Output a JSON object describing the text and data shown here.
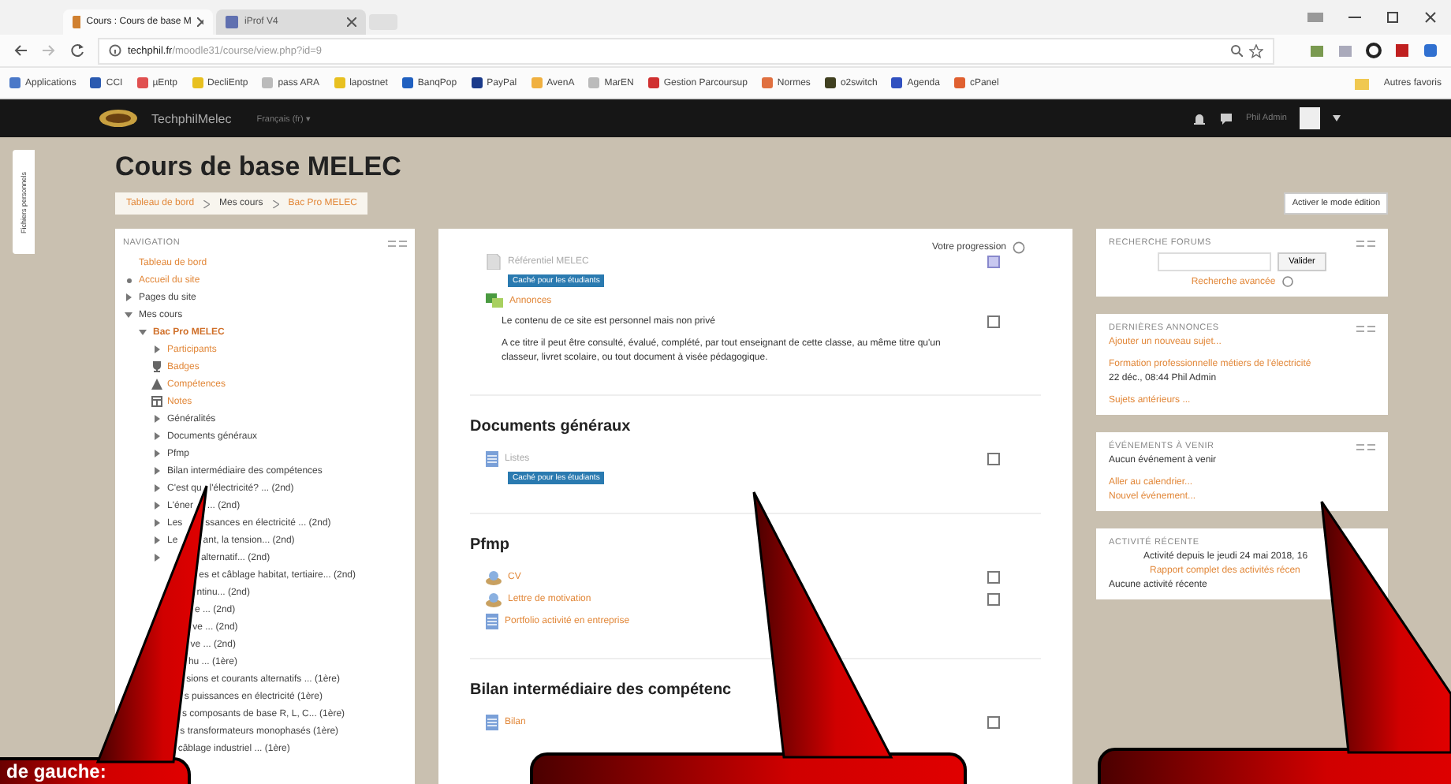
{
  "browser": {
    "tabs": [
      {
        "title": "Cours : Cours de base M",
        "selected": true
      },
      {
        "title": "iProf V4",
        "selected": false
      }
    ],
    "url_host": "techphil.fr",
    "url_path": "/moodle31/course/view.php?id=9",
    "bookmarks": [
      {
        "label": "Applications",
        "color": "#4a78c8"
      },
      {
        "label": "CCI",
        "color": "#2a5ab0"
      },
      {
        "label": "µEntp",
        "color": "#e05050"
      },
      {
        "label": "DecliEntp",
        "color": "#e8c020"
      },
      {
        "label": "pass ARA",
        "color": "#bbbbbb"
      },
      {
        "label": "lapostnet",
        "color": "#e8c020"
      },
      {
        "label": "BanqPop",
        "color": "#2060c0"
      },
      {
        "label": "PayPal",
        "color": "#1a3a8a"
      },
      {
        "label": "AvenA",
        "color": "#f0b040"
      },
      {
        "label": "MarEN",
        "color": "#bbbbbb"
      },
      {
        "label": "Gestion Parcoursup",
        "color": "#d03030"
      },
      {
        "label": "Normes",
        "color": "#e07040"
      },
      {
        "label": "o2switch",
        "color": "#404020"
      },
      {
        "label": "Agenda",
        "color": "#3050c0"
      },
      {
        "label": "cPanel",
        "color": "#e06030"
      }
    ],
    "other_bookmarks": "Autres favoris"
  },
  "navbar": {
    "site_name": "TechphilMelec",
    "language": "Français (fr) ▾",
    "user": "Phil Admin"
  },
  "drawer_tab": "Fichiers personnels",
  "course_title": "Cours de base MELEC",
  "breadcrumb": [
    "Tableau de bord",
    "Mes cours",
    "Bac Pro MELEC"
  ],
  "edit_button": "Activer le mode édition",
  "navigation": {
    "title": "NAVIGATION",
    "items": [
      {
        "text": "Tableau de bord",
        "kind": "root"
      },
      {
        "text": "Accueil du site",
        "kind": "bullet"
      },
      {
        "text": "Pages du site",
        "kind": "node",
        "expanded": false
      },
      {
        "text": "Mes cours",
        "kind": "node",
        "expanded": true,
        "children": [
          {
            "text": "Bac Pro MELEC",
            "kind": "course",
            "expanded": true,
            "children": [
              {
                "text": "Participants",
                "kind": "link-node",
                "expanded": false
              },
              {
                "text": "Badges",
                "kind": "trophy"
              },
              {
                "text": "Compétences",
                "kind": "triangle"
              },
              {
                "text": "Notes",
                "kind": "table"
              },
              {
                "text": "Généralités",
                "kind": "node",
                "expanded": false
              },
              {
                "text": "Documents généraux",
                "kind": "node",
                "expanded": false
              },
              {
                "text": "Pfmp",
                "kind": "node",
                "expanded": false
              },
              {
                "text": "Bilan intermédiaire des compétences",
                "kind": "node",
                "expanded": false
              },
              {
                "text": "C'est qu",
                "tail": "l'électricité? ... (2nd)",
                "kind": "node",
                "expanded": false
              },
              {
                "text": "L'éner",
                "tail": "... (2nd)",
                "kind": "node",
                "expanded": false
              },
              {
                "text": "Les",
                "tail": "ssances en électricité ... (2nd)",
                "kind": "node",
                "expanded": false
              },
              {
                "text": "Le",
                "tail": "ant, la tension... (2nd)",
                "kind": "node",
                "expanded": false
              },
              {
                "tail": "alternatif... (2nd)",
                "expanded": false
              },
              {
                "tail": "es et câblage habitat, tertiaire... (2nd)"
              },
              {
                "tail": "ntinu... (2nd)"
              },
              {
                "tail": "e ... (2nd)"
              },
              {
                "tail": "ve ... (2nd)"
              },
              {
                "tail": "ve ... (2nd)"
              },
              {
                "tail": "hu ... (1ère)"
              },
              {
                "tail": "sions et courants alternatifs ... (1ère)"
              },
              {
                "tail": "s puissances en électricité (1ère)"
              },
              {
                "tail": "s composants de base R, L, C... (1ère)"
              },
              {
                "tail": "s transformateurs monophasés (1ère)"
              },
              {
                "tail": "câblage industriel ... (1ère)"
              }
            ]
          }
        ]
      }
    ]
  },
  "progress_label": "Votre progression",
  "sections": [
    {
      "activities": [
        {
          "name": "Référentiel MELEC",
          "kind": "file",
          "hidden": true,
          "badge": "Caché pour les étudiants",
          "checked": true
        },
        {
          "name": "Annonces",
          "kind": "forum",
          "hidden": false
        }
      ],
      "texts": [
        "Le contenu de ce site est personnel mais non privé",
        "A ce titre il peut être consulté, évalué, complété, par tout enseignant de cette classe, au même titre qu'un classeur, livret scolaire, ou tout document à visée pédagogique."
      ],
      "text_checked": false
    },
    {
      "title": "Documents généraux",
      "activities": [
        {
          "name": "Listes",
          "kind": "page",
          "hidden": true,
          "badge": "Caché pour les étudiants",
          "checked": false
        }
      ]
    },
    {
      "title": "Pfmp",
      "activities": [
        {
          "name": "CV",
          "kind": "assign",
          "hidden": false,
          "checked": false
        },
        {
          "name": "Lettre de motivation",
          "kind": "assign",
          "hidden": false,
          "checked": false
        },
        {
          "name": "Portfolio activité en entreprise",
          "kind": "page",
          "hidden": false
        }
      ]
    },
    {
      "title": "Bilan intermédiaire des compétenc",
      "activities": [
        {
          "name": "Bilan",
          "kind": "page",
          "hidden": false,
          "checked": false
        }
      ]
    }
  ],
  "blocks": [
    {
      "kind": "search",
      "title": "RECHERCHE FORUMS",
      "button": "Valider",
      "link": "Recherche avancée"
    },
    {
      "kind": "news",
      "title": "DERNIÈRES ANNONCES",
      "add": "Ajouter un nouveau sujet...",
      "post": "Formation professionnelle métiers de l'électricité",
      "meta": "22 déc., 08:44 Phil Admin",
      "older": "Sujets antérieurs ..."
    },
    {
      "kind": "events",
      "title": "ÉVÉNEMENTS À VENIR",
      "empty": "Aucun événement à venir",
      "links": [
        "Aller au calendrier...",
        "Nouvel événement..."
      ]
    },
    {
      "kind": "activity",
      "title": "ACTIVITÉ RÉCENTE",
      "since": "Activité depuis le jeudi 24 mai 2018, 16",
      "report": "Rapport complet des activités récen",
      "empty": "Aucune activité récente"
    }
  ],
  "callout_text": "de gauche:"
}
